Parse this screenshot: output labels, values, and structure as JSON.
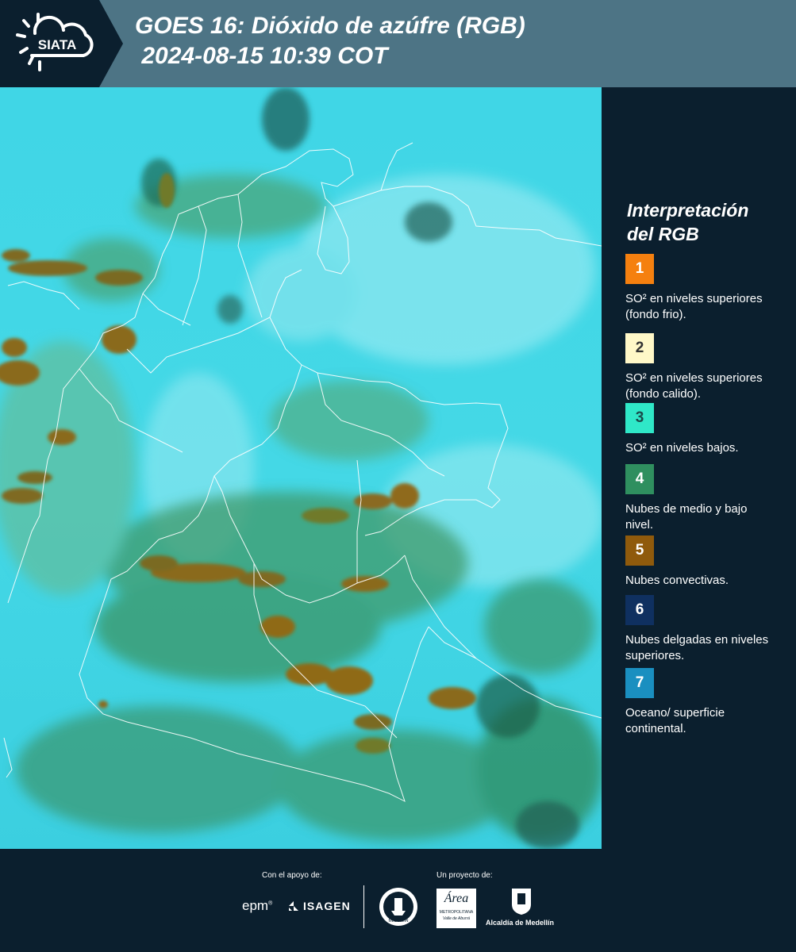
{
  "header": {
    "logo_text": "SIATA",
    "title_line1": "GOES 16: Dióxido de azúfre (RGB)",
    "title_line2": " 2024-08-15 10:39 COT"
  },
  "legend": {
    "title_line1": "Interpretación",
    "title_line2": "del RGB",
    "items": [
      {
        "num": "1",
        "color": "#f5800f",
        "num_color": "#ffffff",
        "text": "SO² en niveles superiores (fondo frio)."
      },
      {
        "num": "2",
        "color": "#fff8c8",
        "num_color": "#333333",
        "text": "SO² en niveles superiores (fondo calido)."
      },
      {
        "num": "3",
        "color": "#2fe8c8",
        "num_color": "#1a4a4a",
        "text": "SO² en niveles bajos."
      },
      {
        "num": "4",
        "color": "#2f8f5f",
        "num_color": "#ffffff",
        "text": "Nubes de medio y bajo nivel."
      },
      {
        "num": "5",
        "color": "#8f5a0c",
        "num_color": "#ffffff",
        "text": "Nubes convectivas."
      },
      {
        "num": "6",
        "color": "#0f3060",
        "num_color": "#ffffff",
        "text": "Nubes delgadas en niveles superiores."
      },
      {
        "num": "7",
        "color": "#1a8fc0",
        "num_color": "#ffffff",
        "text": "Oceano/ superficie continental."
      }
    ]
  },
  "footer": {
    "support_label": "Con el apoyo de:",
    "project_label": "Un proyecto de:",
    "epm": "epm",
    "isagen": "ISAGEN",
    "medellin_seal": "MEDELLÍN",
    "area_name": "Área",
    "area_sub1": "METROPOLITANA",
    "area_sub2": "Valle de Aburrá",
    "alcaldia": "Alcaldía de Medellín"
  },
  "colors": {
    "header_bg": "#4d7485",
    "dark_bg": "#0b1f2e",
    "ocean_cyan": "#3fd4e4",
    "cloud_green": "#2f7a3a",
    "convective": "#8f5a0c"
  }
}
